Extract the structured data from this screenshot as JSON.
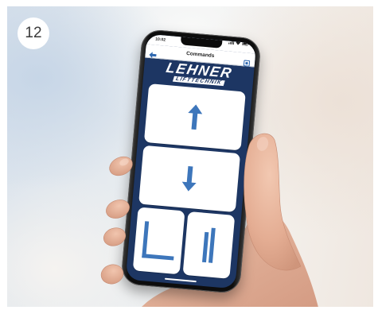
{
  "step_badge": "12",
  "phone": {
    "status_bar": {
      "time": "10:02",
      "icons": [
        "signal-icon",
        "wifi-icon",
        "battery-icon"
      ]
    },
    "header": {
      "title": "Commands",
      "left_icon": "back-arrow-icon",
      "right_icon": "square-icon"
    },
    "logo": {
      "brand": "LEHNER",
      "subtitle": "LIFTTECHNIK"
    },
    "commands": [
      {
        "icon": "arrow-up-icon"
      },
      {
        "icon": "arrow-down-icon"
      },
      {
        "icon": "corner-l-icon"
      },
      {
        "icon": "double-bar-icon"
      }
    ]
  },
  "colors": {
    "screen_background": "#1d3663",
    "accent": "#3d76bb",
    "button_background": "#ffffff",
    "badge_background": "#ffffff"
  }
}
